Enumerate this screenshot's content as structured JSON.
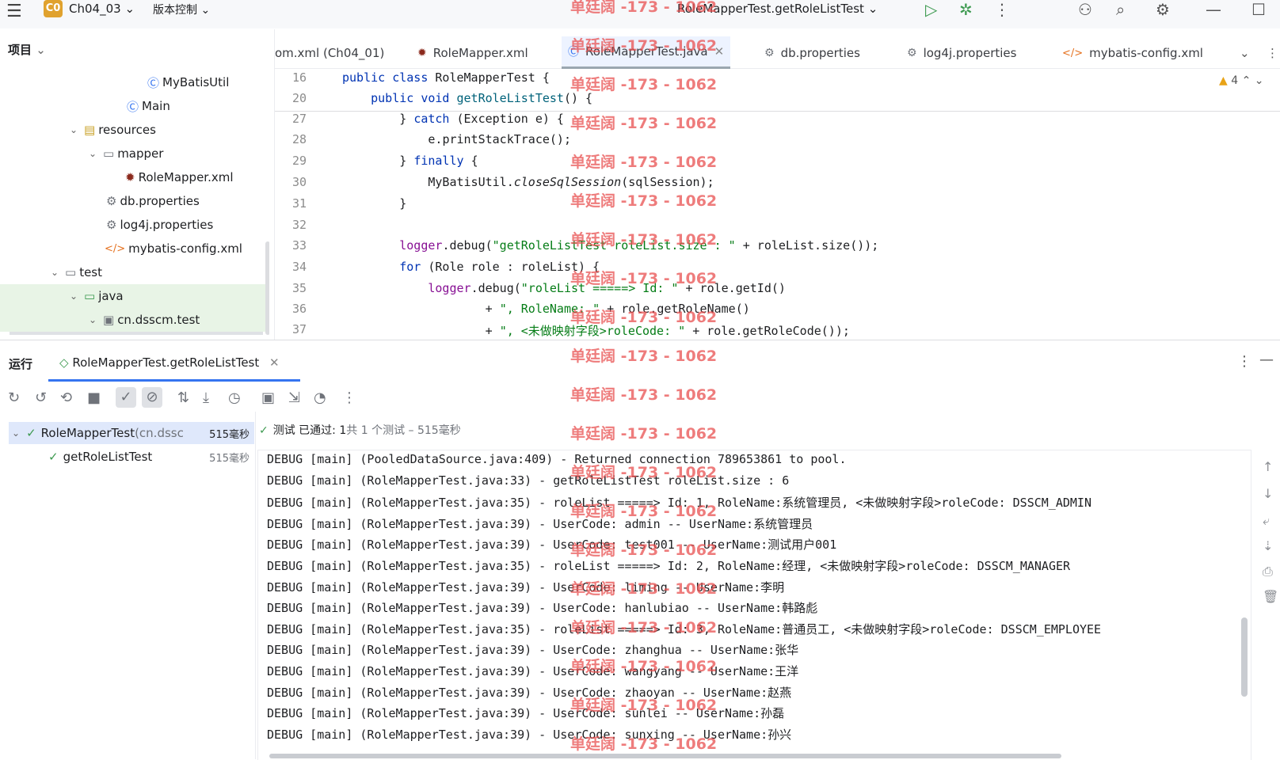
{
  "titlebar": {
    "project_badge": "C0",
    "project_name": "Ch04_03",
    "vcs_menu": "版本控制",
    "run_config": "RoleMapperTest.getRoleListTest"
  },
  "tabs": [
    {
      "label": "om.xml (Ch04_01)",
      "icon": "maven-icon"
    },
    {
      "label": "RoleMapper.xml",
      "icon": "mybatis-icon"
    },
    {
      "label": "RoleMapperTest.java",
      "icon": "test-class-icon",
      "active": true
    },
    {
      "label": "db.properties",
      "icon": "gear-icon"
    },
    {
      "label": "log4j.properties",
      "icon": "gear-icon"
    },
    {
      "label": "mybatis-config.xml",
      "icon": "xml-icon"
    }
  ],
  "project_panel": {
    "title": "项目",
    "tree": [
      {
        "label": "MyBatisUtil",
        "icon": "class-icon"
      },
      {
        "label": "Main",
        "icon": "class-icon"
      },
      {
        "label": "resources",
        "icon": "resources-folder-icon"
      },
      {
        "label": "mapper",
        "icon": "folder-icon"
      },
      {
        "label": "RoleMapper.xml",
        "icon": "mybatis-icon"
      },
      {
        "label": "db.properties",
        "icon": "gear-icon"
      },
      {
        "label": "log4j.properties",
        "icon": "gear-icon"
      },
      {
        "label": "mybatis-config.xml",
        "icon": "xml-icon"
      },
      {
        "label": "test",
        "icon": "folder-icon"
      },
      {
        "label": "java",
        "icon": "test-folder-icon"
      },
      {
        "label": "cn.dsscm.test",
        "icon": "package-icon"
      }
    ]
  },
  "editor": {
    "warnings": "4",
    "lines": [
      {
        "n": "16",
        "parts": [
          [
            "kw",
            "public class "
          ],
          [
            "",
            "RoleMapperTest {"
          ]
        ]
      },
      {
        "n": "20",
        "parts": [
          [
            "kw",
            "    public void "
          ],
          [
            "fn",
            "getRoleListTest"
          ],
          [
            "",
            "() {"
          ]
        ]
      },
      {
        "n": "27",
        "parts": [
          [
            "",
            "        } "
          ],
          [
            "kw",
            "catch "
          ],
          [
            "",
            "(Exception e) {"
          ]
        ]
      },
      {
        "n": "28",
        "parts": [
          [
            "",
            "            e."
          ],
          [
            "",
            "printStackTrace"
          ],
          [
            "",
            "();"
          ]
        ]
      },
      {
        "n": "29",
        "parts": [
          [
            "",
            "        } "
          ],
          [
            "kw",
            "finally "
          ],
          [
            "",
            "{"
          ]
        ]
      },
      {
        "n": "30",
        "parts": [
          [
            "",
            "            MyBatisUtil."
          ],
          [
            "it",
            "closeSqlSession"
          ],
          [
            "",
            "(sqlSession);"
          ]
        ]
      },
      {
        "n": "31",
        "parts": [
          [
            "",
            "        }"
          ]
        ]
      },
      {
        "n": "32",
        "parts": [
          [
            "",
            ""
          ]
        ]
      },
      {
        "n": "33",
        "parts": [
          [
            "log",
            "        logger"
          ],
          [
            "",
            ".debug("
          ],
          [
            "str",
            "\"getRoleListTest roleList.size : \""
          ],
          [
            "",
            " + roleList.size());"
          ]
        ]
      },
      {
        "n": "34",
        "parts": [
          [
            "kw",
            "        for "
          ],
          [
            "",
            "(Role role : roleList) {"
          ]
        ]
      },
      {
        "n": "35",
        "parts": [
          [
            "log",
            "            logger"
          ],
          [
            "",
            ".debug("
          ],
          [
            "str",
            "\"roleList =====> Id: \""
          ],
          [
            "",
            " + role.getId()"
          ]
        ]
      },
      {
        "n": "36",
        "parts": [
          [
            "",
            "                    + "
          ],
          [
            "str",
            "\", RoleName: \""
          ],
          [
            "",
            " + role.getRoleName()"
          ]
        ]
      },
      {
        "n": "37",
        "parts": [
          [
            "",
            "                    + "
          ],
          [
            "str",
            "\", <未做映射字段>roleCode: \""
          ],
          [
            "",
            " + role.getRoleCode());"
          ]
        ]
      }
    ]
  },
  "run_panel": {
    "title": "运行",
    "tab_label": "RoleMapperTest.getRoleListTest",
    "status": {
      "prefix": "测试 已通过: ",
      "count": "1",
      "suffix": "共 1 个测试 – 515毫秒"
    },
    "tests": [
      {
        "name": "RoleMapperTest",
        "pkg": " (cn.dssc",
        "time": "515毫秒"
      },
      {
        "name": "getRoleListTest",
        "pkg": "",
        "time": "515毫秒"
      }
    ],
    "console": [
      "DEBUG [main] (PooledDataSource.java:409) - Returned connection 789653861 to pool.",
      "DEBUG [main] (RoleMapperTest.java:33) - getRoleListTest roleList.size : 6",
      "DEBUG [main] (RoleMapperTest.java:35) - roleList =====> Id: 1, RoleName:系统管理员, <未做映射字段>roleCode: DSSCM_ADMIN",
      "DEBUG [main] (RoleMapperTest.java:39) - UserCode: admin -- UserName:系统管理员",
      "DEBUG [main] (RoleMapperTest.java:39) - UserCode: test001 -- UserName:测试用户001",
      "DEBUG [main] (RoleMapperTest.java:35) - roleList =====> Id: 2, RoleName:经理, <未做映射字段>roleCode: DSSCM_MANAGER",
      "DEBUG [main] (RoleMapperTest.java:39) - UserCode: liming -- UserName:李明",
      "DEBUG [main] (RoleMapperTest.java:39) - UserCode: hanlubiao -- UserName:韩路彪",
      "DEBUG [main] (RoleMapperTest.java:35) - roleList =====> Id: 3, RoleName:普通员工, <未做映射字段>roleCode: DSSCM_EMPLOYEE",
      "DEBUG [main] (RoleMapperTest.java:39) - UserCode: zhanghua -- UserName:张华",
      "DEBUG [main] (RoleMapperTest.java:39) - UserCode: wangyang -- UserName:王洋",
      "DEBUG [main] (RoleMapperTest.java:39) - UserCode: zhaoyan -- UserName:赵燕",
      "DEBUG [main] (RoleMapperTest.java:39) - UserCode: sunlei -- UserName:孙磊",
      "DEBUG [main] (RoleMapperTest.java:39) - UserCode: sunxing -- UserName:孙兴"
    ]
  },
  "watermark": "单廷阔 -173 - 1062"
}
